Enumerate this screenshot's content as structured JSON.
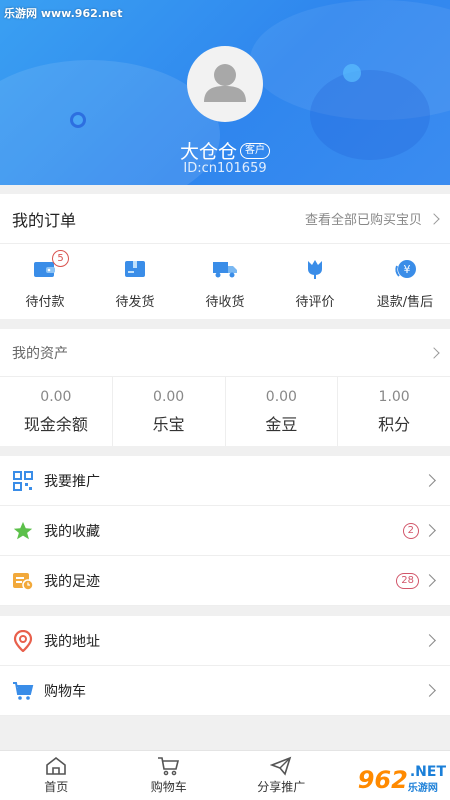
{
  "watermark": {
    "top_text": "乐游网 www.962.net",
    "corner_num": "962",
    "corner_net": ".NET",
    "corner_cn": "乐游网"
  },
  "profile": {
    "name": "大仓仓",
    "role": "客户",
    "id": "ID:cn101659"
  },
  "orders": {
    "title": "我的订单",
    "view_all": "查看全部已购买宝贝",
    "items": [
      {
        "label": "待付款",
        "icon": "wallet-icon",
        "badge": "5"
      },
      {
        "label": "待发货",
        "icon": "package-icon"
      },
      {
        "label": "待收货",
        "icon": "truck-icon"
      },
      {
        "label": "待评价",
        "icon": "tulip-icon"
      },
      {
        "label": "退款/售后",
        "icon": "refund-yen-icon"
      }
    ]
  },
  "assets": {
    "title": "我的资产",
    "items": [
      {
        "value": "0.00",
        "name": "现金余额"
      },
      {
        "value": "0.00",
        "name": "乐宝"
      },
      {
        "value": "0.00",
        "name": "金豆"
      },
      {
        "value": "1.00",
        "name": "积分"
      }
    ]
  },
  "menu1": [
    {
      "label": "我要推广",
      "icon": "qrcode-icon"
    },
    {
      "label": "我的收藏",
      "icon": "star-icon",
      "count": "2"
    },
    {
      "label": "我的足迹",
      "icon": "footprint-icon",
      "count": "28"
    }
  ],
  "menu2": [
    {
      "label": "我的地址",
      "icon": "location-icon"
    },
    {
      "label": "购物车",
      "icon": "cart-icon"
    }
  ],
  "nav": [
    {
      "label": "首页",
      "icon": "home-icon"
    },
    {
      "label": "购物车",
      "icon": "cart-icon"
    },
    {
      "label": "分享推广",
      "icon": "share-icon"
    }
  ],
  "colors": {
    "header": "#2f86ee",
    "badge": "#d9534f",
    "icon_blue": "#3a8de8"
  }
}
